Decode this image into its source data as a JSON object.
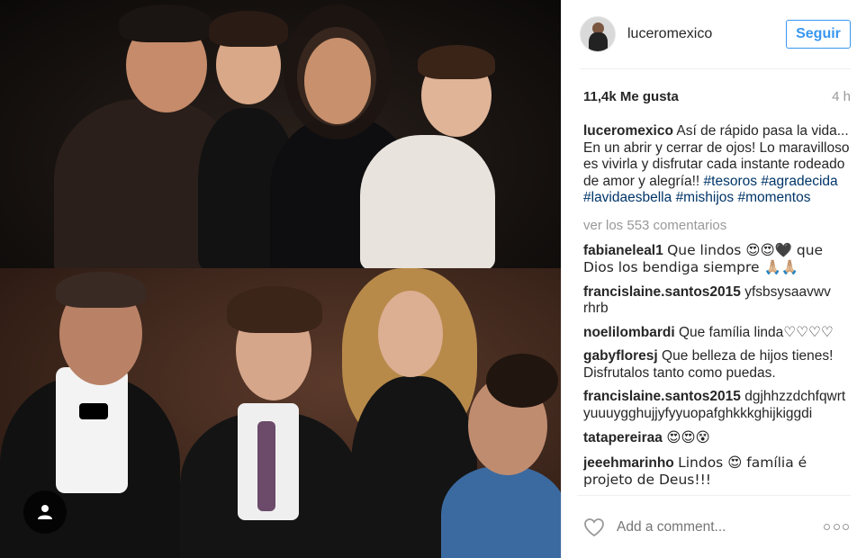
{
  "post": {
    "username": "luceromexico",
    "follow_label": "Seguir",
    "likes": "11,4k Me gusta",
    "time": "4 h",
    "caption_user": "luceromexico",
    "caption_text": "Así de rápido pasa la vida... En un abrir y cerrar de ojos! Lo maravilloso es vivirla y disfrutar cada instante rodeado de amor y alegría!!",
    "hashtags": [
      "#tesoros",
      "#agradecida",
      "#lavidaesbella",
      "#mishijos",
      "#momentos"
    ],
    "view_comments": "ver los 553 comentarios",
    "comments": [
      {
        "user": "fabianeleal1",
        "text": "Que lindos 😍😍🖤 que Dios los bendiga siempre 🙏🏼🙏🏼"
      },
      {
        "user": "francislaine.santos2015",
        "text": "yfsbsysaavwv rhrb"
      },
      {
        "user": "noelilombardi",
        "text": "Que família linda♡♡♡♡"
      },
      {
        "user": "gabyfloresj",
        "text": "Que belleza de hijos tienes! Disfrutalos tanto como puedas."
      },
      {
        "user": "francislaine.santos2015",
        "text": "dgjhhzzdchfqwrt yuuuygghujjyfyyuopafghkkkghijkiggdi"
      },
      {
        "user": "tatapereiraa",
        "text": "😍😍😵"
      },
      {
        "user": "jeeehmarinho",
        "text": "Lindos 😍 família é projeto de Deus!!!"
      }
    ],
    "comment_placeholder": "Add a comment..."
  },
  "colors": {
    "accent": "#3897f0",
    "hashtag": "#003569",
    "muted": "#999999"
  },
  "icons": [
    "person-tag-icon",
    "heart-icon",
    "more-options-icon"
  ]
}
